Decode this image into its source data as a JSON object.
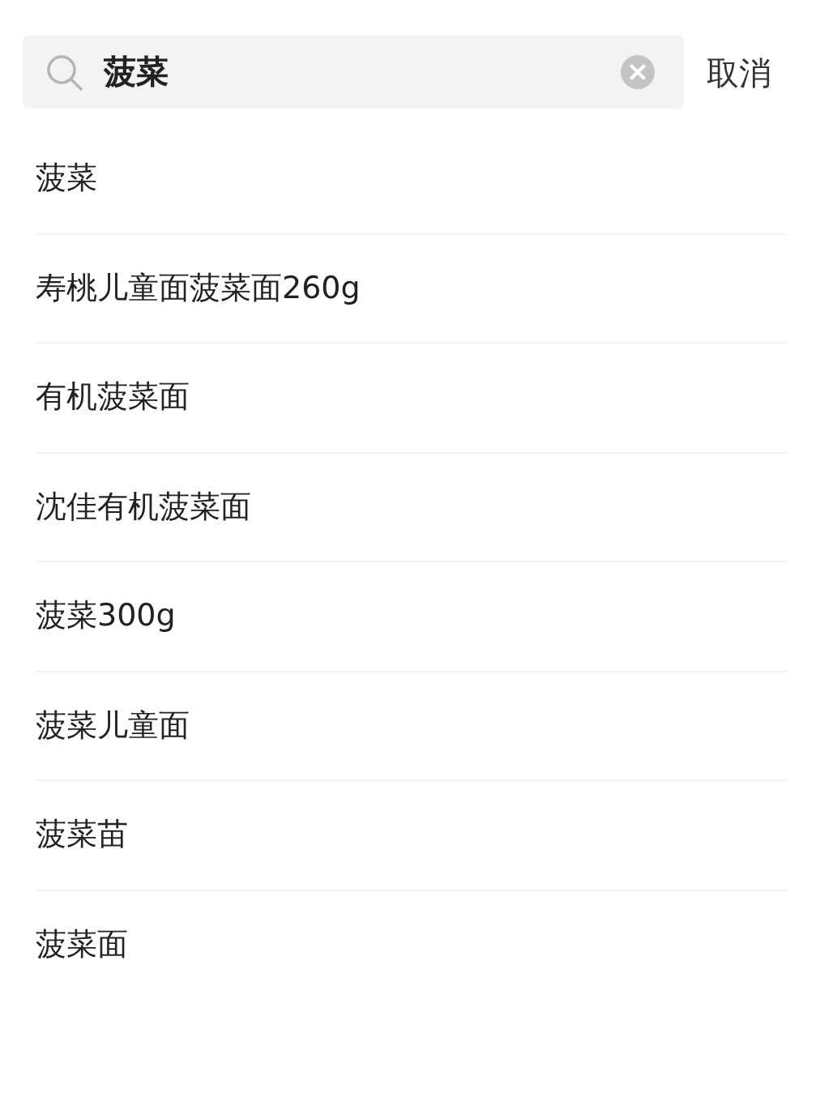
{
  "search": {
    "value": "菠菜"
  },
  "cancel": "取消",
  "suggestions": [
    "菠菜",
    "寿桃儿童面菠菜面260g",
    "有机菠菜面",
    "沈佳有机菠菜面",
    "菠菜300g",
    "菠菜儿童面",
    "菠菜苗",
    "菠菜面"
  ]
}
